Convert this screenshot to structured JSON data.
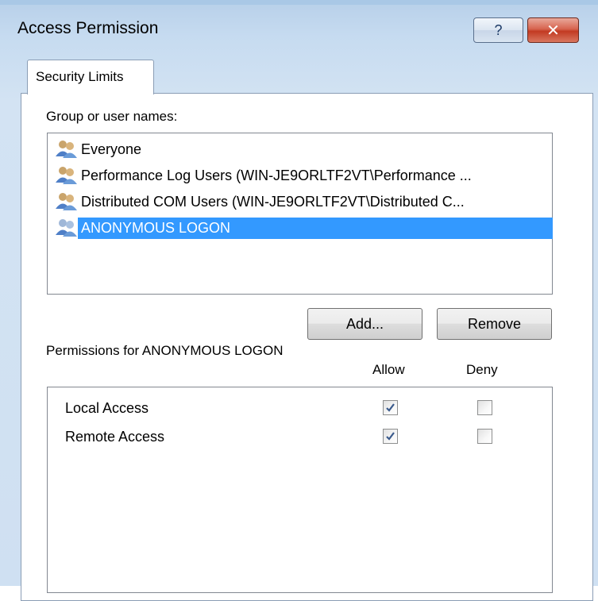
{
  "window": {
    "title": "Access Permission",
    "help_label": "?",
    "close_label": "✕"
  },
  "tabs": [
    {
      "label": "Security Limits"
    }
  ],
  "users": {
    "label": "Group or user names:",
    "items": [
      {
        "name": "Everyone",
        "icon": "users-icon"
      },
      {
        "name": "Performance Log Users (WIN-JE9ORLTF2VT\\Performance ...",
        "icon": "users-icon"
      },
      {
        "name": "Distributed COM Users (WIN-JE9ORLTF2VT\\Distributed C...",
        "icon": "users-icon"
      },
      {
        "name": "ANONYMOUS LOGON",
        "icon": "users-icon",
        "selected": true
      }
    ],
    "selection_color": "#3399ff"
  },
  "buttons": {
    "add": "Add...",
    "remove": "Remove"
  },
  "permissions": {
    "label": "Permissions for ANONYMOUS LOGON",
    "allow_header": "Allow",
    "deny_header": "Deny",
    "rows": [
      {
        "name": "Local Access",
        "allow": true,
        "deny": false
      },
      {
        "name": "Remote Access",
        "allow": true,
        "deny": false
      }
    ]
  }
}
